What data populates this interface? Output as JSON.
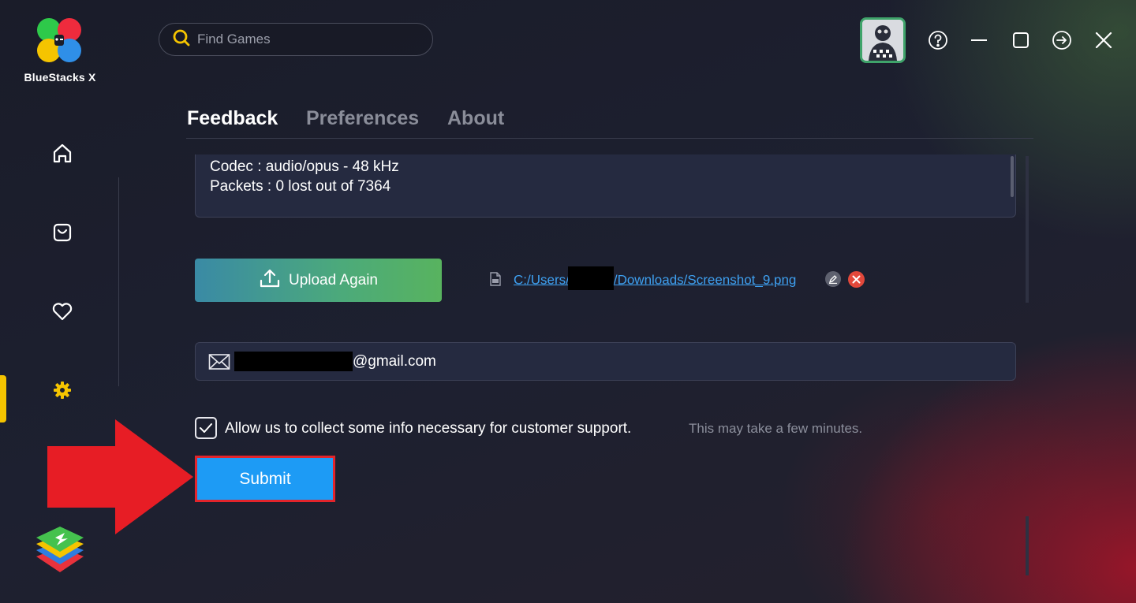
{
  "app": {
    "brand": "BlueStacks X"
  },
  "search": {
    "placeholder": "Find Games"
  },
  "tabs": [
    {
      "label": "Feedback",
      "active": true
    },
    {
      "label": "Preferences",
      "active": false
    },
    {
      "label": "About",
      "active": false
    }
  ],
  "log": {
    "lines": [
      {
        "key": "Codec",
        "sep": " : ",
        "value": "audio/opus - 48 kHz"
      },
      {
        "key": "Packets",
        "sep": " : ",
        "value": "0 lost out of 7364"
      }
    ]
  },
  "upload": {
    "label": "Upload Again"
  },
  "attachment": {
    "path_prefix": "C:/Users/",
    "path_suffix": "/Downloads/Screenshot_9.png"
  },
  "email": {
    "suffix": "@gmail.com"
  },
  "consent": {
    "checked": true,
    "label": "Allow us to collect some info necessary for customer support.",
    "hint": "This may take a few minutes."
  },
  "submit": {
    "label": "Submit"
  },
  "colors": {
    "accent": "#f5c400",
    "submit": "#1d9bf5",
    "highlight": "#e3242b",
    "link": "#3ea0f0"
  }
}
